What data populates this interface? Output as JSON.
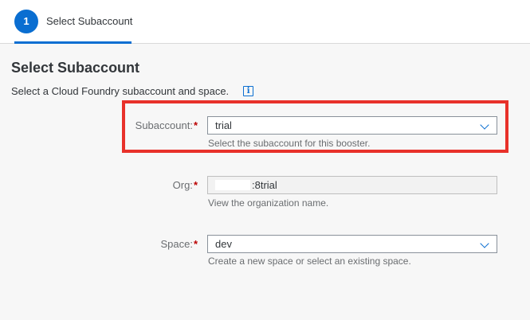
{
  "wizard": {
    "step_number": "1",
    "step_label": "Select Subaccount"
  },
  "page": {
    "title": "Select Subaccount",
    "description": "Select a Cloud Foundry subaccount and space.",
    "info_icon": "info-icon"
  },
  "fields": {
    "subaccount": {
      "label": "Subaccount:",
      "required": "*",
      "value": "trial",
      "hint": "Select the subaccount for this booster."
    },
    "org": {
      "label": "Org:",
      "required": "*",
      "value": ":8trial",
      "hint": "View the organization name."
    },
    "space": {
      "label": "Space:",
      "required": "*",
      "value": "dev",
      "hint": "Create a new space or select an existing space."
    }
  },
  "colors": {
    "accent": "#0a6ed1",
    "required": "#bb0000",
    "highlight": "#e8312a"
  }
}
